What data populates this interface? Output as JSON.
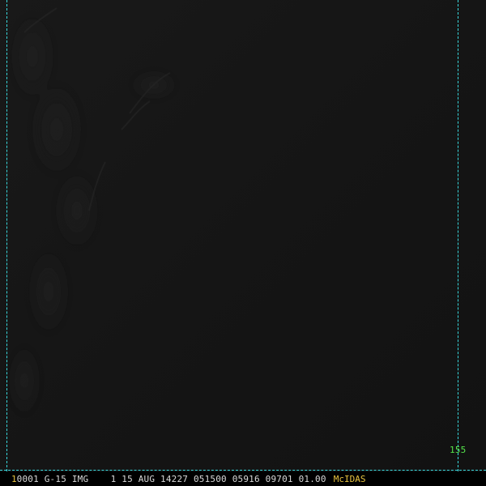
{
  "status_bar": {
    "frame_number": "1",
    "info": "0001 G-15 IMG    1 15 AUG 14227 051500 05916 09701 01.00",
    "brand": "McIDAS"
  },
  "corner_label": "155",
  "colors": {
    "grid": "#38d7dc",
    "corner_label": "#55e34a",
    "frame_number": "#e7c23f",
    "brand": "#e7c23f",
    "status_text": "#d9d9d9",
    "background": "#151515"
  }
}
